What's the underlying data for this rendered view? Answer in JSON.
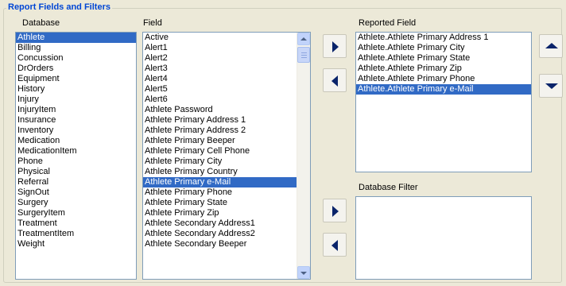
{
  "group": {
    "title": "Report Fields and Filters"
  },
  "labels": {
    "database": "Database",
    "field": "Field",
    "reported_field": "Reported Field",
    "database_filter": "Database Filter"
  },
  "database_list": [
    {
      "label": "Athlete",
      "selected": true
    },
    {
      "label": "Billing"
    },
    {
      "label": "Concussion"
    },
    {
      "label": "DrOrders"
    },
    {
      "label": "Equipment"
    },
    {
      "label": "History"
    },
    {
      "label": "Injury"
    },
    {
      "label": "InjuryItem"
    },
    {
      "label": "Insurance"
    },
    {
      "label": "Inventory"
    },
    {
      "label": "Medication"
    },
    {
      "label": "MedicationItem"
    },
    {
      "label": "Phone"
    },
    {
      "label": "Physical"
    },
    {
      "label": "Referral"
    },
    {
      "label": "SignOut"
    },
    {
      "label": "Surgery"
    },
    {
      "label": "SurgeryItem"
    },
    {
      "label": "Treatment"
    },
    {
      "label": "TreatmentItem"
    },
    {
      "label": "Weight"
    }
  ],
  "field_list": [
    {
      "label": "Active"
    },
    {
      "label": "Alert1"
    },
    {
      "label": "Alert2"
    },
    {
      "label": "Alert3"
    },
    {
      "label": "Alert4"
    },
    {
      "label": "Alert5"
    },
    {
      "label": "Alert6"
    },
    {
      "label": "Athlete Password"
    },
    {
      "label": "Athlete Primary Address 1"
    },
    {
      "label": "Athlete Primary Address 2"
    },
    {
      "label": "Athlete Primary Beeper"
    },
    {
      "label": "Athlete Primary Cell Phone"
    },
    {
      "label": "Athlete Primary City"
    },
    {
      "label": "Athlete Primary Country"
    },
    {
      "label": "Athlete Primary e-Mail",
      "selected": true
    },
    {
      "label": "Athlete Primary Phone"
    },
    {
      "label": "Athlete Primary State"
    },
    {
      "label": "Athlete Primary Zip"
    },
    {
      "label": "Athlete Secondary Address1"
    },
    {
      "label": "Athlete Secondary Address2"
    },
    {
      "label": "Athlete Secondary Beeper"
    }
  ],
  "reported_list": [
    {
      "label": "Athlete.Athlete Primary Address 1"
    },
    {
      "label": "Athlete.Athlete Primary City"
    },
    {
      "label": "Athlete.Athlete Primary State"
    },
    {
      "label": "Athlete.Athlete Primary Zip"
    },
    {
      "label": "Athlete.Athlete Primary Phone"
    },
    {
      "label": "Athlete.Athlete Primary e-Mail",
      "selected": true
    }
  ],
  "filter_list": [],
  "buttons": {
    "add_field": "arrow-right-icon",
    "remove_field": "arrow-left-icon",
    "move_up": "arrow-up-icon",
    "move_down": "arrow-down-icon",
    "add_filter": "arrow-right-icon",
    "remove_filter": "arrow-left-icon"
  },
  "colors": {
    "group_title": "#0046D5",
    "selection": "#316AC5",
    "arrow": "#0A246A"
  }
}
